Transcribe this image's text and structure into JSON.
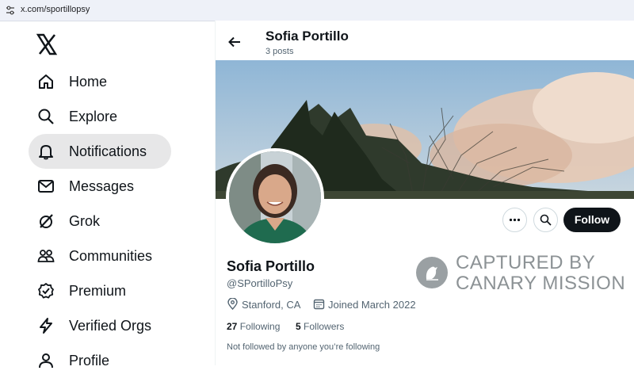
{
  "browser": {
    "url": "x.com/sportillopsy"
  },
  "sidebar": {
    "items": [
      {
        "label": "Home"
      },
      {
        "label": "Explore"
      },
      {
        "label": "Notifications"
      },
      {
        "label": "Messages"
      },
      {
        "label": "Grok"
      },
      {
        "label": "Communities"
      },
      {
        "label": "Premium"
      },
      {
        "label": "Verified Orgs"
      },
      {
        "label": "Profile"
      }
    ],
    "active": "Notifications"
  },
  "header": {
    "name": "Sofia Portillo",
    "posts": "3 posts"
  },
  "profile": {
    "name": "Sofia Portillo",
    "handle": "@SPortilloPsy",
    "location": "Stanford, CA",
    "joined": "Joined March 2022",
    "following_count": "27",
    "following_label": "Following",
    "followers_count": "5",
    "followers_label": "Followers",
    "not_followed": "Not followed by anyone you’re following",
    "follow_label": "Follow"
  },
  "watermark": {
    "line1": "CAPTURED BY",
    "line2": "CANARY MISSION"
  },
  "colors": {
    "text": "#0f1419",
    "muted": "#536471",
    "active_bg": "#e7e7e8",
    "follow_bg": "#0f1419"
  }
}
